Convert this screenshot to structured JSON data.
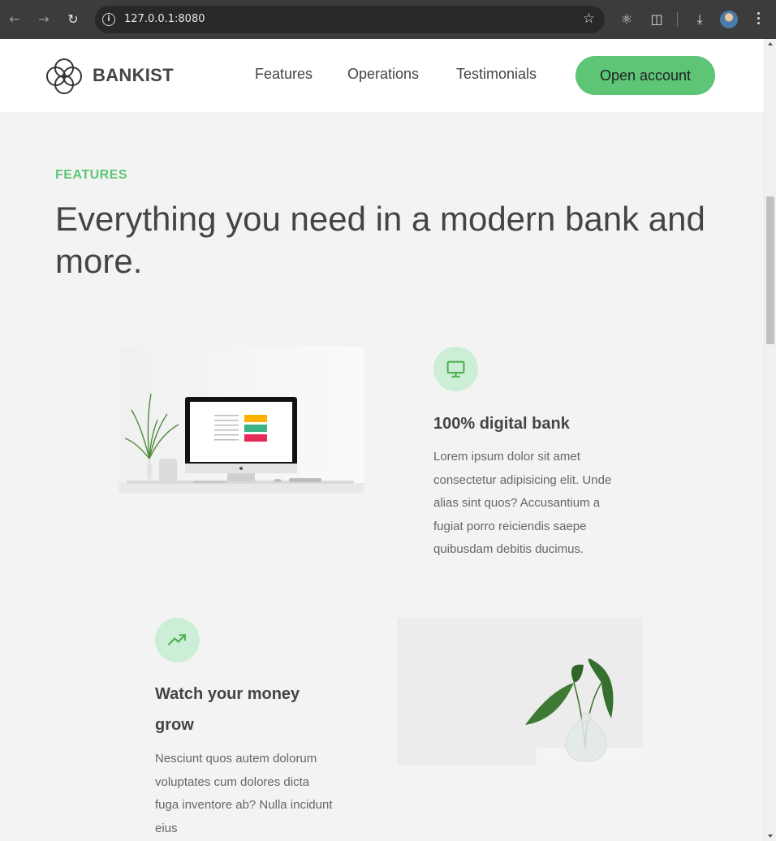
{
  "browser": {
    "url": "127.0.0.1:8080"
  },
  "nav": {
    "brand": "BANKIST",
    "links": [
      "Features",
      "Operations",
      "Testimonials"
    ],
    "cta": "Open account"
  },
  "features": {
    "label": "FEATURES",
    "headline": "Everything you need in a modern bank and more.",
    "items": [
      {
        "icon": "monitor-icon",
        "title": "100% digital bank",
        "text": "Lorem ipsum dolor sit amet consectetur adipisicing elit. Unde alias sint quos? Accusantium a fugiat porro reiciendis saepe quibusdam debitis ducimus."
      },
      {
        "icon": "trending-up-icon",
        "title": "Watch your money grow",
        "text": "Nesciunt quos autem dolorum voluptates cum dolores dicta fuga inventore ab? Nulla incidunt eius"
      }
    ]
  },
  "colors": {
    "accent": "#5ec576",
    "icon_bg": "#cdeed6",
    "text": "#444444",
    "page_bg": "#f3f3f3"
  }
}
